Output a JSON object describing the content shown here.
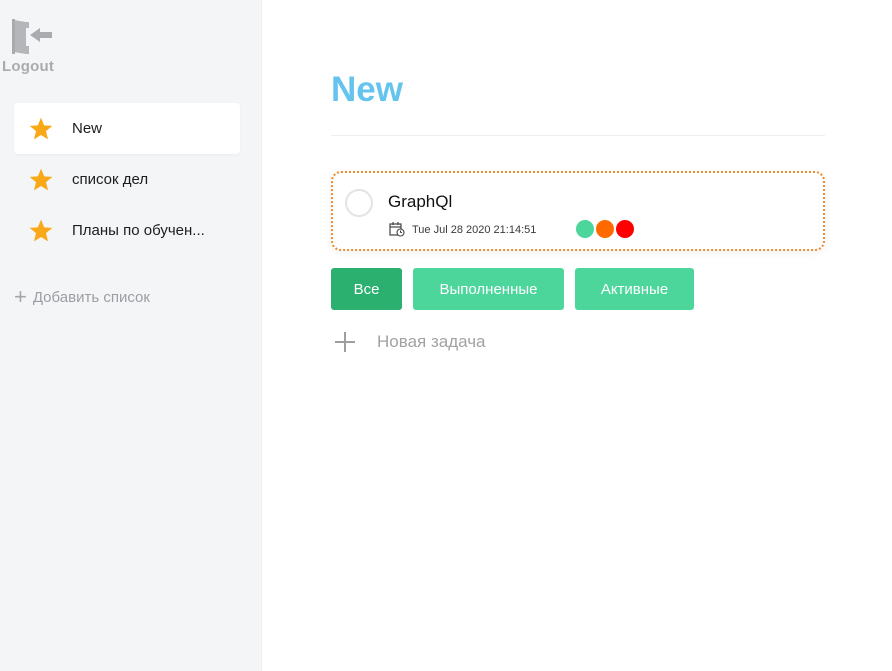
{
  "sidebar": {
    "logout_label": "Logout",
    "lists": [
      {
        "label": "New",
        "active": true
      },
      {
        "label": "список дел",
        "active": false
      },
      {
        "label": "Планы по обучен...",
        "active": false
      }
    ],
    "add_list_label": "Добавить список"
  },
  "main": {
    "title": "New",
    "tasks": [
      {
        "title": "GraphQl",
        "date": "Tue Jul 28 2020 21:14:51",
        "colors": [
          "#4cd69b",
          "#ff6a00",
          "#ff0000"
        ]
      }
    ],
    "filters": [
      {
        "label": "Все",
        "color": "#2bb06f",
        "width": 71
      },
      {
        "label": "Выполненные",
        "color": "#4cd69b",
        "width": 151
      },
      {
        "label": "Активные",
        "color": "#4cd69b",
        "width": 119
      }
    ],
    "new_task_label": "Новая задача"
  },
  "colors": {
    "accent_title": "#64c4ed",
    "star": "#f9a818",
    "card_border": "#f08a2c"
  }
}
